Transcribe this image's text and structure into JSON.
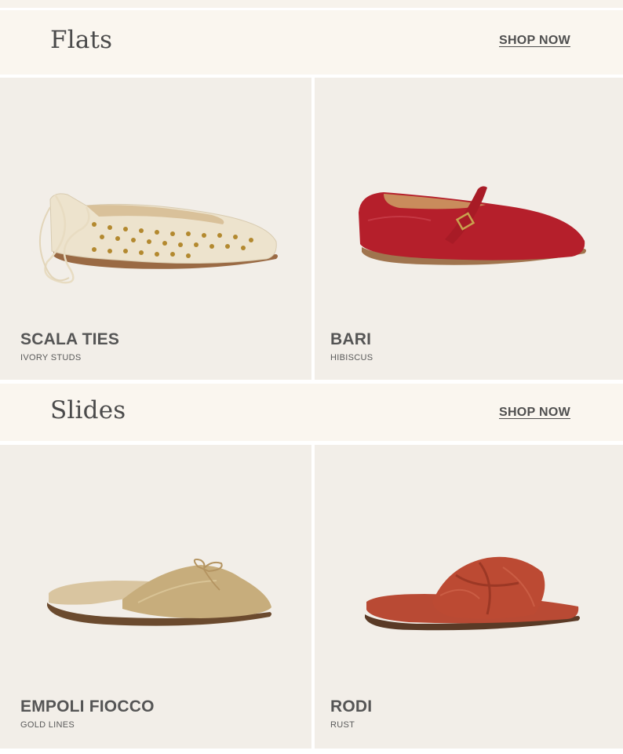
{
  "sections": [
    {
      "title": "Flats",
      "link_label": "SHOP NOW",
      "products": [
        {
          "name": "SCALA TIES",
          "variant": "IVORY STUDS",
          "icon": "ivory-studded-flat-icon",
          "color": "#ece3cf"
        },
        {
          "name": "BARI",
          "variant": "HIBISCUS",
          "icon": "red-mary-jane-flat-icon",
          "color": "#b51f2b"
        }
      ]
    },
    {
      "title": "Slides",
      "link_label": "SHOP NOW",
      "products": [
        {
          "name": "EMPOLI FIOCCO",
          "variant": "GOLD LINES",
          "icon": "gold-bow-mule-icon",
          "color": "#c7ad7c"
        },
        {
          "name": "RODI",
          "variant": "RUST",
          "icon": "rust-knot-slide-icon",
          "color": "#b94a34"
        }
      ]
    }
  ],
  "colors": {
    "header_bg": "#faf6ef",
    "card_bg": "#f2eee8",
    "text": "#555555"
  }
}
